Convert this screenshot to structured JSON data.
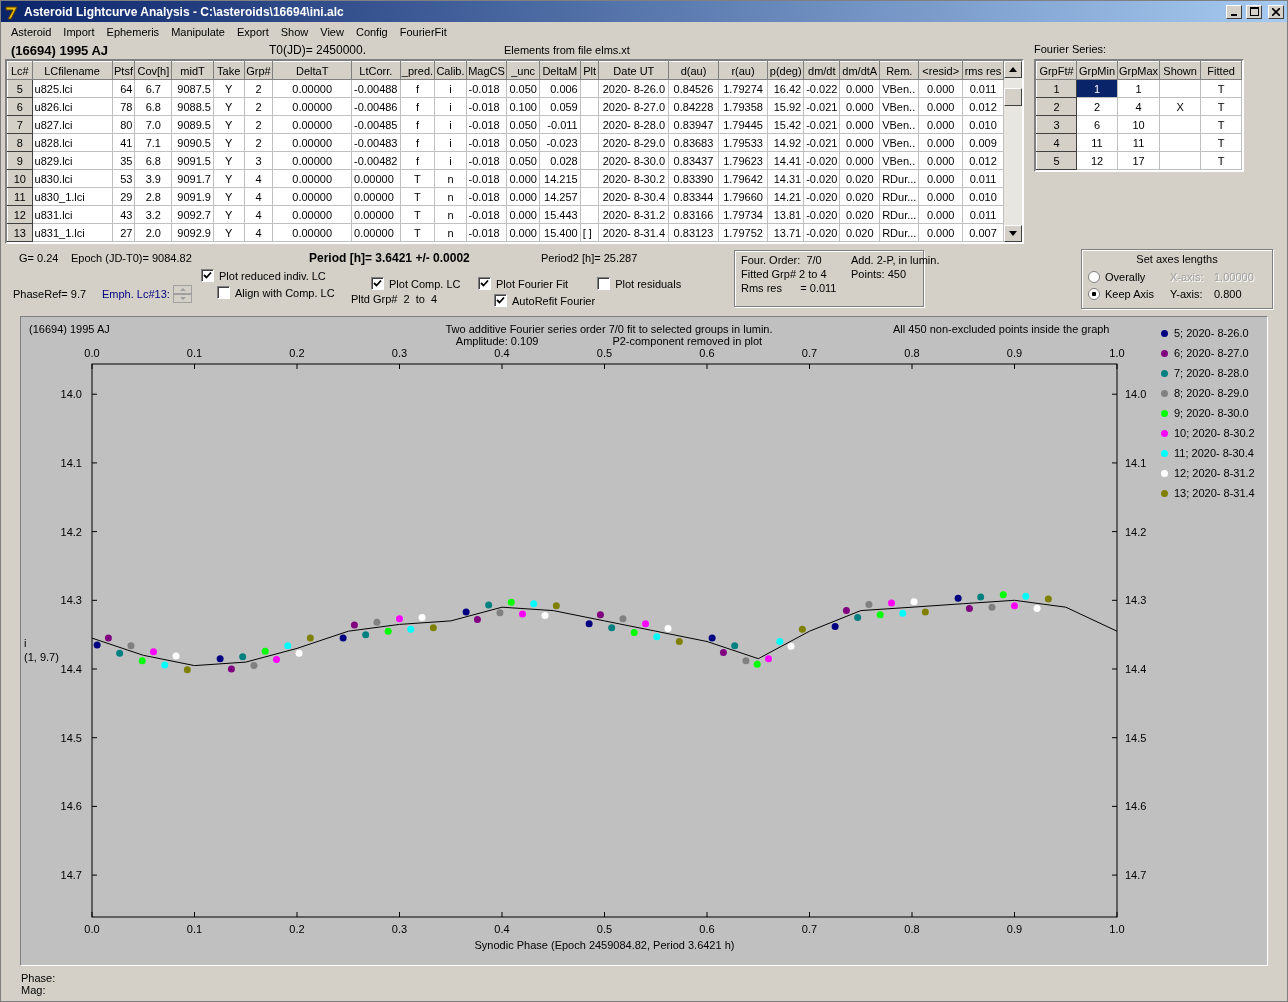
{
  "window": {
    "title": "Asteroid Lightcurve Analysis - C:\\asteroids\\16694\\ini.alc"
  },
  "menu": [
    "Asteroid",
    "Import",
    "Ephemeris",
    "Manipulate",
    "Export",
    "Show",
    "View",
    "Config",
    "FourierFit"
  ],
  "header": {
    "asteroid": "(16694) 1995 AJ",
    "t0": "T0(JD)= 2450000.",
    "elements": "Elements from file elms.xt"
  },
  "table": {
    "columns": [
      "Lc#",
      "LCfilename",
      "Ptsf",
      "Cov[h]",
      "midT",
      "Take",
      "Grp#",
      "DeltaT",
      "LtCorr.",
      "_pred.",
      "Calib.",
      "MagCS",
      "_unc",
      "DeltaM",
      "Plt",
      "Date UT",
      "d(au)",
      "r(au)",
      "p(deg)",
      "dm/dt",
      "dm/dtA",
      "Rem.",
      "<resid>",
      "rms res"
    ],
    "rows": [
      {
        "cells": [
          "5",
          "u825.lci",
          "64",
          "6.7",
          "9087.5",
          "Y",
          "2",
          "0.00000",
          "-0.00488",
          "f",
          "i",
          "-0.018",
          "0.050",
          "0.006",
          null,
          "2020- 8-26.0",
          "0.84526",
          "1.79274",
          "16.42",
          "-0.022",
          "0.000",
          "VBen..",
          "0.000",
          "0.011"
        ]
      },
      {
        "cells": [
          "6",
          "u826.lci",
          "78",
          "6.8",
          "9088.5",
          "Y",
          "2",
          "0.00000",
          "-0.00486",
          "f",
          "i",
          "-0.018",
          "0.100",
          "0.059",
          null,
          "2020- 8-27.0",
          "0.84228",
          "1.79358",
          "15.92",
          "-0.021",
          "0.000",
          "VBen..",
          "0.000",
          "0.012"
        ]
      },
      {
        "cells": [
          "7",
          "u827.lci",
          "80",
          "7.0",
          "9089.5",
          "Y",
          "2",
          "0.00000",
          "-0.00485",
          "f",
          "i",
          "-0.018",
          "0.050",
          "-0.011",
          null,
          "2020- 8-28.0",
          "0.83947",
          "1.79445",
          "15.42",
          "-0.021",
          "0.000",
          "VBen..",
          "0.000",
          "0.010"
        ]
      },
      {
        "cells": [
          "8",
          "u828.lci",
          "41",
          "7.1",
          "9090.5",
          "Y",
          "2",
          "0.00000",
          "-0.00483",
          "f",
          "i",
          "-0.018",
          "0.050",
          "-0.023",
          null,
          "2020- 8-29.0",
          "0.83683",
          "1.79533",
          "14.92",
          "-0.021",
          "0.000",
          "VBen..",
          "0.000",
          "0.009"
        ]
      },
      {
        "cells": [
          "9",
          "u829.lci",
          "35",
          "6.8",
          "9091.5",
          "Y",
          "3",
          "0.00000",
          "-0.00482",
          "f",
          "i",
          "-0.018",
          "0.050",
          "0.028",
          null,
          "2020- 8-30.0",
          "0.83437",
          "1.79623",
          "14.41",
          "-0.020",
          "0.000",
          "VBen..",
          "0.000",
          "0.012"
        ]
      },
      {
        "cells": [
          "10",
          "u830.lci",
          "53",
          "3.9",
          "9091.7",
          "Y",
          "4",
          "0.00000",
          "0.00000",
          "T",
          "n",
          "-0.018",
          "0.000",
          "14.215",
          null,
          "2020- 8-30.2",
          "0.83390",
          "1.79642",
          "14.31",
          "-0.020",
          "0.020",
          "RDur...",
          "0.000",
          "0.011"
        ]
      },
      {
        "cells": [
          "11",
          "u830_1.lci",
          "29",
          "2.8",
          "9091.9",
          "Y",
          "4",
          "0.00000",
          "0.00000",
          "T",
          "n",
          "-0.018",
          "0.000",
          "14.257",
          null,
          "2020- 8-30.4",
          "0.83344",
          "1.79660",
          "14.21",
          "-0.020",
          "0.020",
          "RDur...",
          "0.000",
          "0.010"
        ]
      },
      {
        "cells": [
          "12",
          "u831.lci",
          "43",
          "3.2",
          "9092.7",
          "Y",
          "4",
          "0.00000",
          "0.00000",
          "T",
          "n",
          "-0.018",
          "0.000",
          "15.443",
          null,
          "2020- 8-31.2",
          "0.83166",
          "1.79734",
          "13.81",
          "-0.020",
          "0.020",
          "RDur...",
          "0.000",
          "0.011"
        ]
      },
      {
        "cells": [
          "13",
          "u831_1.lci",
          "27",
          "2.0",
          "9092.9",
          "Y",
          "4",
          "0.00000",
          "0.00000",
          "T",
          "n",
          "-0.018",
          "0.000",
          "15.400",
          "[ ]",
          "2020- 8-31.4",
          "0.83123",
          "1.79752",
          "13.71",
          "-0.020",
          "0.020",
          "RDur...",
          "0.000",
          "0.007"
        ]
      }
    ]
  },
  "fourier_series": {
    "label": "Fourier Series:",
    "columns": [
      "GrpFt#",
      "GrpMin",
      "GrpMax",
      "Shown",
      "Fitted"
    ],
    "rows": [
      {
        "cells": [
          {
            "text": "1",
            "selected": false
          },
          {
            "text": "1",
            "selected": true
          },
          {
            "text": "1",
            "selected": false
          },
          {
            "selected": false
          },
          {
            "text": "T",
            "selected": false
          }
        ]
      },
      {
        "cells": [
          {
            "text": "2",
            "selected": false
          },
          {
            "text": "2",
            "selected": false
          },
          {
            "text": "4",
            "selected": false
          },
          {
            "text": "X",
            "selected": false
          },
          {
            "text": "T",
            "selected": false
          }
        ]
      },
      {
        "cells": [
          {
            "text": "3",
            "selected": false
          },
          {
            "text": "6",
            "selected": false
          },
          {
            "text": "10",
            "selected": false
          },
          {
            "selected": false
          },
          {
            "text": "T",
            "selected": false
          }
        ]
      },
      {
        "cells": [
          {
            "text": "4",
            "selected": false
          },
          {
            "text": "11",
            "selected": false
          },
          {
            "text": "11",
            "selected": false
          },
          {
            "selected": false
          },
          {
            "text": "T",
            "selected": false
          }
        ]
      },
      {
        "cells": [
          {
            "text": "5",
            "selected": false
          },
          {
            "text": "12",
            "selected": false
          },
          {
            "text": "17",
            "selected": false
          },
          {
            "selected": false
          },
          {
            "text": "T",
            "selected": false
          }
        ]
      }
    ]
  },
  "info": {
    "g": "G= 0.24",
    "epoch": "Epoch (JD-T0)= 9084.82",
    "period": "Period [h]= 3.6421 +/- 0.0002",
    "period2": "Period2 [h]= 25.287",
    "phase_ref": "PhaseRef= 9.7",
    "emph": "Emph. Lc#13:",
    "pltd_grp": "Pltd Grp#  2  to  4"
  },
  "options": [
    {
      "label": "Plot reduced indiv. LC",
      "checked": true
    },
    {
      "label": "Align with Comp. LC",
      "checked": false
    },
    {
      "label": "Plot Comp. LC",
      "checked": true
    },
    {
      "label": "Plot Fourier Fit",
      "checked": true
    },
    {
      "label": "AutoRefit Fourier",
      "checked": true
    },
    {
      "label": "Plot residuals",
      "checked": false
    }
  ],
  "fit_summary": [
    "Four. Order:  7/0",
    "Add. 2-P, in lumin.",
    "Fitted Grp# 2 to 4",
    "Points: 450",
    "Rms res      = 0.011"
  ],
  "axes": {
    "title": "Set axes lengths",
    "options": [
      {
        "label": "Overally",
        "selected": false,
        "axis_label": "X-axis:",
        "axis_value": "1.00000",
        "disabled": true
      },
      {
        "label": "Keep Axis",
        "selected": true,
        "axis_label": "Y-axis:",
        "axis_value": "0.800",
        "disabled": false
      }
    ]
  },
  "plot": {
    "corner_label": "(16694) 1995 AJ",
    "subtitle_left": "Amplitude: 0.109",
    "subtitle_right": "P2-component removed in plot",
    "note": "All 450 non-excluded points inside the graph",
    "chart_data": {
      "type": "scatter",
      "title": "Two additive Fourier series order 7/0 fit to selected groups in lumin.",
      "xlabel": "Synodic Phase (Epoch 2459084.82, Period 3.6421 h)",
      "annotations": [
        {
          "text": "i"
        },
        {
          "text": "(1, 9.7)"
        }
      ],
      "legend": "right",
      "xlim": [
        0,
        1
      ],
      "ylim": [
        14.761,
        13.956
      ],
      "xticks": [
        {
          "value": 0,
          "label": "0.0"
        },
        {
          "value": 0.1,
          "label": "0.1"
        },
        {
          "value": 0.2,
          "label": "0.2"
        },
        {
          "value": 0.3,
          "label": "0.3"
        },
        {
          "value": 0.4,
          "label": "0.4"
        },
        {
          "value": 0.5,
          "label": "0.5"
        },
        {
          "value": 0.6,
          "label": "0.6"
        },
        {
          "value": 0.7,
          "label": "0.7"
        },
        {
          "value": 0.8,
          "label": "0.8"
        },
        {
          "value": 0.9,
          "label": "0.9"
        },
        {
          "value": 1,
          "label": "1.0"
        }
      ],
      "yticks": [
        {
          "value": 14.0,
          "label": "14.0"
        },
        {
          "value": 14.1,
          "label": "14.1"
        },
        {
          "value": 14.2,
          "label": "14.2"
        },
        {
          "value": 14.3,
          "label": "14.3"
        },
        {
          "value": 14.4,
          "label": "14.4"
        },
        {
          "value": 14.5,
          "label": "14.5"
        },
        {
          "value": 14.6,
          "label": "14.6"
        },
        {
          "value": 14.7,
          "label": "14.7"
        }
      ],
      "series": [
        {
          "name": "5; 2020- 8-26.0",
          "color": "#000080",
          "x": [
            0.005,
            0.125,
            0.245,
            0.365,
            0.485,
            0.605,
            0.725,
            0.845
          ],
          "values": [
            14.365,
            14.385,
            14.355,
            14.317,
            14.334,
            14.355,
            14.338,
            14.297
          ]
        },
        {
          "name": "6; 2020- 8-27.0",
          "color": "#800080",
          "x": [
            0.016,
            0.136,
            0.256,
            0.376,
            0.496,
            0.616,
            0.736,
            0.856
          ],
          "values": [
            14.355,
            14.4,
            14.336,
            14.328,
            14.321,
            14.376,
            14.315,
            14.312
          ]
        },
        {
          "name": "7; 2020- 8-28.0",
          "color": "#008080",
          "x": [
            0.027,
            0.147,
            0.267,
            0.387,
            0.507,
            0.627,
            0.747,
            0.867
          ],
          "values": [
            14.377,
            14.382,
            14.35,
            14.307,
            14.34,
            14.366,
            14.325,
            14.295
          ]
        },
        {
          "name": "8; 2020- 8-29.0",
          "color": "#808080",
          "x": [
            0.038,
            0.158,
            0.278,
            0.398,
            0.518,
            0.638,
            0.758,
            0.878
          ],
          "values": [
            14.366,
            14.395,
            14.332,
            14.318,
            14.327,
            14.388,
            14.306,
            14.31
          ]
        },
        {
          "name": "9; 2020- 8-30.0",
          "color": "#00ff00",
          "x": [
            0.049,
            0.169,
            0.289,
            0.409,
            0.529,
            0.649,
            0.769,
            0.889
          ],
          "values": [
            14.388,
            14.374,
            14.345,
            14.303,
            14.347,
            14.393,
            14.321,
            14.292
          ]
        },
        {
          "name": "10; 2020- 8-30.2",
          "color": "#ff00ff",
          "x": [
            0.06,
            0.18,
            0.3,
            0.42,
            0.54,
            0.66,
            0.78,
            0.9
          ],
          "values": [
            14.375,
            14.386,
            14.327,
            14.32,
            14.334,
            14.385,
            14.304,
            14.308
          ]
        },
        {
          "name": "11; 2020- 8-30.4",
          "color": "#00ffff",
          "x": [
            0.071,
            0.191,
            0.311,
            0.431,
            0.551,
            0.671,
            0.791,
            0.911
          ],
          "values": [
            14.394,
            14.366,
            14.342,
            14.305,
            14.353,
            14.36,
            14.319,
            14.294
          ]
        },
        {
          "name": "12; 2020- 8-31.2",
          "color": "#ffffff",
          "x": [
            0.082,
            0.202,
            0.322,
            0.442,
            0.562,
            0.682,
            0.802,
            0.922
          ],
          "values": [
            14.381,
            14.377,
            14.325,
            14.322,
            14.341,
            14.367,
            14.302,
            14.312
          ]
        },
        {
          "name": "13; 2020- 8-31.4",
          "color": "#808000",
          "x": [
            0.093,
            0.213,
            0.333,
            0.453,
            0.573,
            0.693,
            0.813,
            0.933
          ],
          "values": [
            14.401,
            14.355,
            14.34,
            14.308,
            14.36,
            14.342,
            14.317,
            14.298
          ]
        },
        {
          "color": "#000000",
          "type": "line",
          "x": [
            0,
            0.05,
            0.1,
            0.15,
            0.2,
            0.25,
            0.3,
            0.35,
            0.4,
            0.45,
            0.5,
            0.55,
            0.6,
            0.65,
            0.7,
            0.75,
            0.8,
            0.85,
            0.9,
            0.95,
            1
          ],
          "values": [
            14.355,
            14.38,
            14.395,
            14.39,
            14.37,
            14.345,
            14.335,
            14.33,
            14.31,
            14.315,
            14.33,
            14.345,
            14.36,
            14.385,
            14.345,
            14.315,
            14.31,
            14.305,
            14.3,
            14.31,
            14.345
          ]
        }
      ]
    }
  },
  "status": [
    "Phase:",
    "Mag:"
  ]
}
